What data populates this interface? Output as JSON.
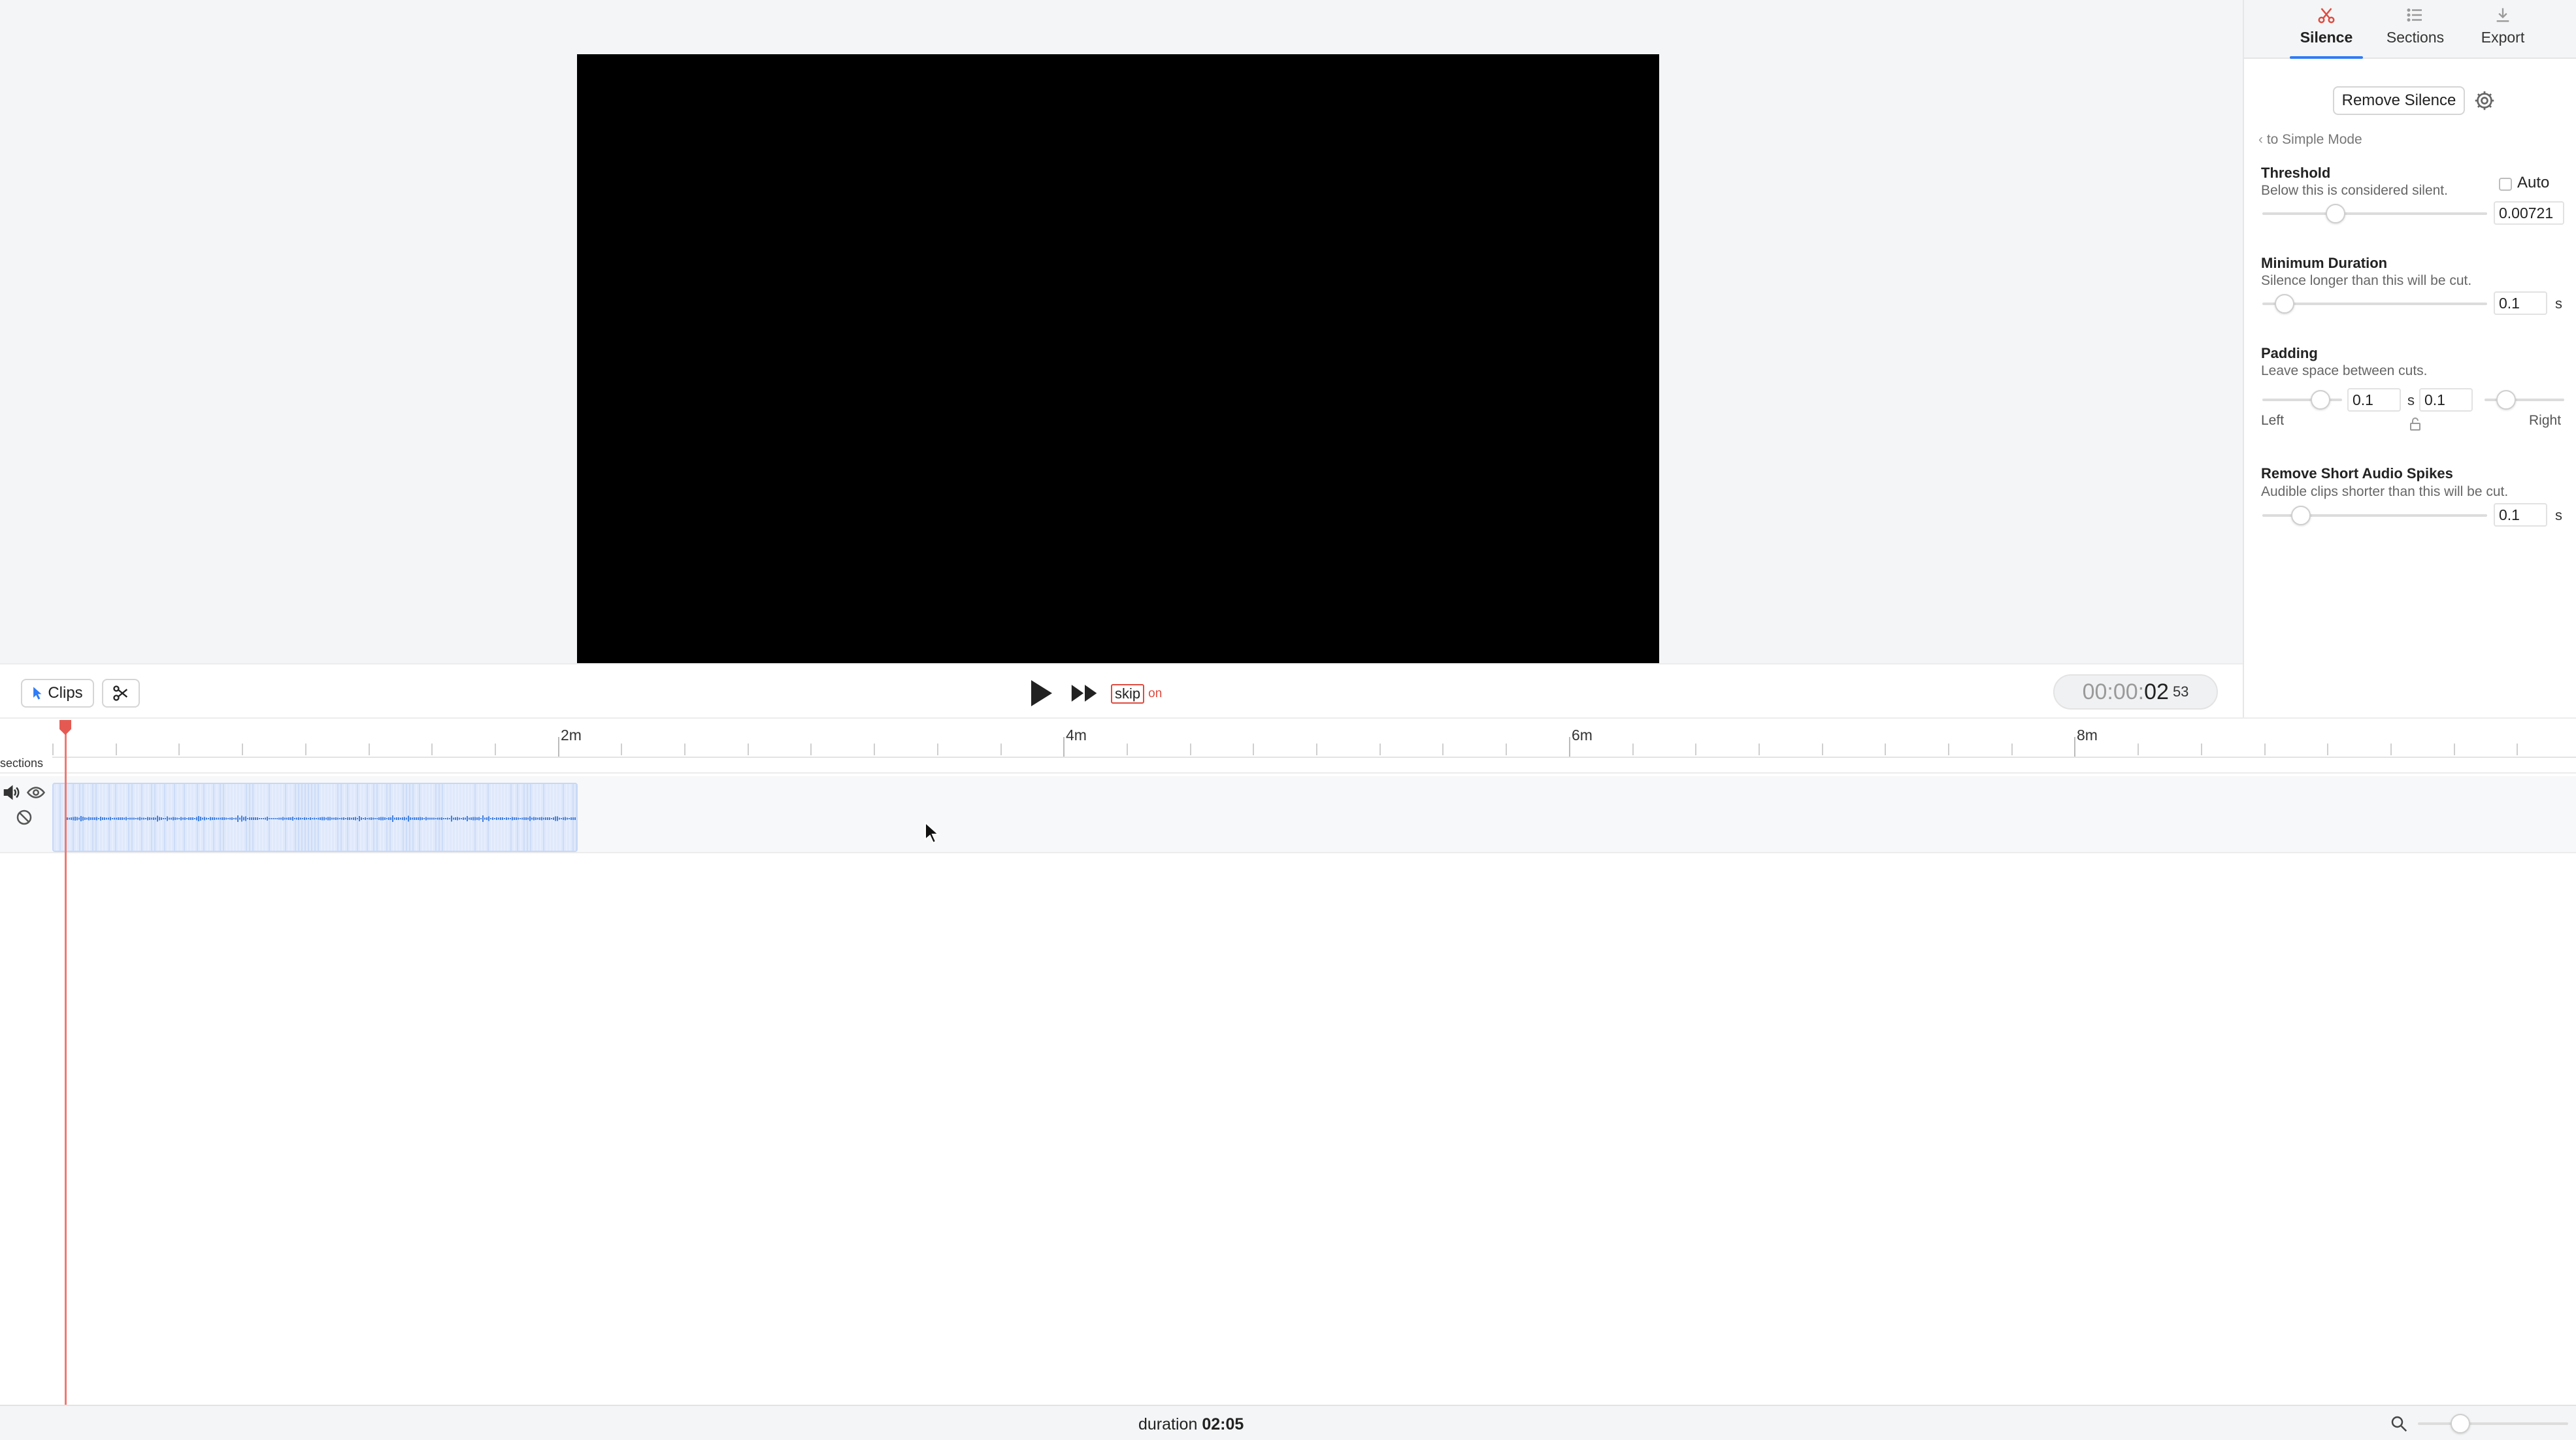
{
  "tabs": [
    {
      "label": "Silence",
      "icon": "scissors-icon",
      "active": true
    },
    {
      "label": "Sections",
      "icon": "list-icon",
      "active": false
    },
    {
      "label": "Export",
      "icon": "download-icon",
      "active": false
    }
  ],
  "panel": {
    "remove_silence_label": "Remove Silence",
    "simple_mode_link": "to Simple Mode",
    "threshold": {
      "title": "Threshold",
      "desc": "Below this is considered silent.",
      "auto_label": "Auto",
      "auto_checked": false,
      "value": "0.00721",
      "slider_fraction": 0.31
    },
    "min_duration": {
      "title": "Minimum Duration",
      "desc": "Silence longer than this will be cut.",
      "value": "0.1",
      "unit": "s",
      "slider_fraction": 0.06
    },
    "padding": {
      "title": "Padding",
      "desc": "Leave space between cuts.",
      "left_value": "0.1",
      "right_value": "0.1",
      "unit": "s",
      "left_label": "Left",
      "right_label": "Right",
      "left_slider_fraction": 0.8,
      "right_slider_fraction": 0.2,
      "lock_icon": "lock-icon"
    },
    "spikes": {
      "title": "Remove Short Audio Spikes",
      "desc": "Audible clips shorter than this will be cut.",
      "value": "0.1",
      "unit": "s",
      "slider_fraction": 0.14
    }
  },
  "controls": {
    "clips_label": "Clips",
    "skip_label": "skip",
    "skip_state": "on",
    "timecode_main": "00:00:",
    "timecode_sec": "02",
    "timecode_frames": "53"
  },
  "timeline": {
    "tick_labels": [
      "2m",
      "4m",
      "6m",
      "8m"
    ],
    "sections_label": "sections"
  },
  "status": {
    "duration_label": "duration",
    "duration_value": "02:05",
    "zoom_fraction": 0.25
  },
  "colors": {
    "accent": "#2f7cf6",
    "skip_red": "#e04a3f",
    "playhead": "#ee7a74",
    "clip_fill": "#dfe9fb",
    "wave": "#3f7fe0"
  }
}
